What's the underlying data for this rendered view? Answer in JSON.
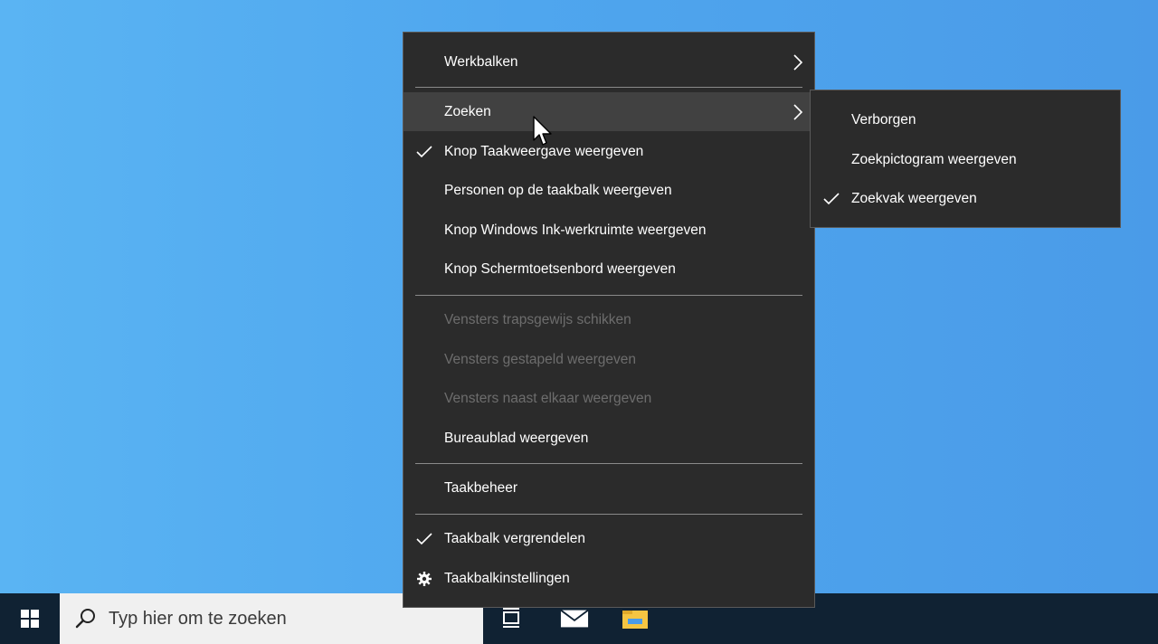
{
  "context_menu": {
    "items": [
      {
        "label": "Werkbalken",
        "has_submenu": true
      },
      {
        "label": "Zoeken",
        "has_submenu": true,
        "highlighted": true
      },
      {
        "label": "Knop Taakweergave weergeven",
        "checked": true
      },
      {
        "label": "Personen op de taakbalk weergeven"
      },
      {
        "label": "Knop Windows Ink-werkruimte weergeven"
      },
      {
        "label": "Knop Schermtoetsenbord weergeven"
      },
      {
        "label": "Vensters trapsgewijs schikken",
        "disabled": true
      },
      {
        "label": "Vensters gestapeld weergeven",
        "disabled": true
      },
      {
        "label": "Vensters naast elkaar weergeven",
        "disabled": true
      },
      {
        "label": "Bureaublad weergeven"
      },
      {
        "label": "Taakbeheer"
      },
      {
        "label": "Taakbalk vergrendelen",
        "checked": true
      },
      {
        "label": "Taakbalkinstellingen",
        "icon": "gear-icon"
      }
    ]
  },
  "submenu": {
    "items": [
      {
        "label": "Verborgen"
      },
      {
        "label": "Zoekpictogram weergeven"
      },
      {
        "label": "Zoekvak weergeven",
        "checked": true
      }
    ]
  },
  "taskbar": {
    "search_placeholder": "Typ hier om te zoeken",
    "icons": [
      "windows-start-icon",
      "search-icon",
      "task-view-icon",
      "mail-icon",
      "file-explorer-icon"
    ]
  },
  "colors": {
    "menu_bg": "#2b2b2b",
    "menu_hover": "#414141",
    "menu_text": "#ffffff",
    "menu_disabled_text": "#6d6d6d",
    "taskbar_bg": "#102233",
    "desktop_bg": "#5ab4f3"
  }
}
